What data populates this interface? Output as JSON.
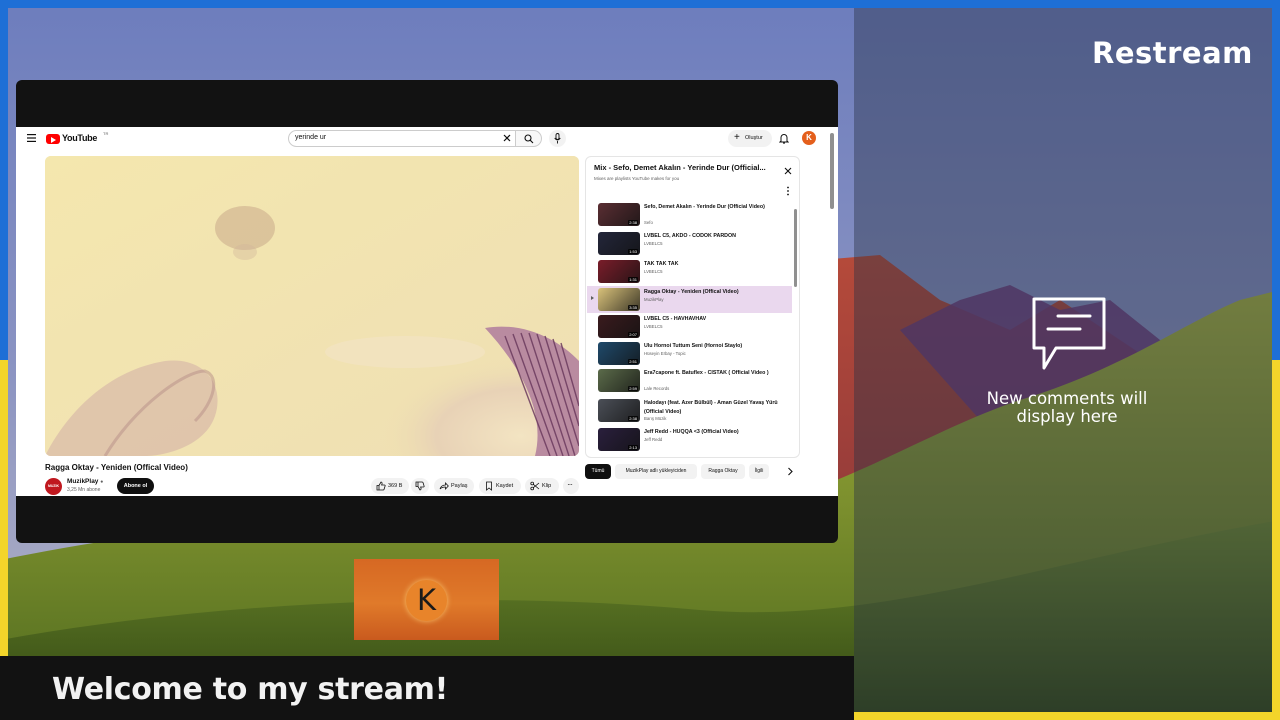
{
  "brand": "Restream",
  "banner": "Welcome to my stream!",
  "chat": {
    "empty_message": "New comments will display here",
    "icon": "chat-bubble-icon"
  },
  "camera": {
    "avatar_letter": "K",
    "color": "#e07a2a"
  },
  "youtube": {
    "search_value": "yerinde ur",
    "create_label": "Oluştur",
    "avatar_letter": "K",
    "logo_text": "YouTube",
    "logo_country": "TR",
    "video_title": "Ragga Oktay - Yeniden (Offical Video)",
    "channel_name": "MuzikPlay",
    "channel_avatar_text": "MUZIK PLAY",
    "subscribers": "3,25 Mn abone",
    "subscribe_label": "Abone ol",
    "actions": {
      "likes": "369 B",
      "share": "Paylaş",
      "save": "Kaydet",
      "clip": "Klip"
    },
    "playlist": {
      "title": "Mix - Sefo, Demet Akalın - Yerinde Dur (Official...",
      "subtitle": "Mixes are playlists YouTube makes for you",
      "items": [
        {
          "title": "Sefo, Demet Akalın - Yerinde Dur (Official Video)",
          "channel": "Sefo",
          "duration": "2:38",
          "color": "#5a2e33"
        },
        {
          "title": "LVBEL C5, AKDO - CODOK PARDON",
          "channel": "LVBELC5",
          "duration": "1:53",
          "color": "#23263a"
        },
        {
          "title": "TAK TAK TAK",
          "channel": "LVBELC5",
          "duration": "1:31",
          "color": "#7a1d2a"
        },
        {
          "title": "Ragga Oktay - Yeniden (Offical Video)",
          "channel": "MuzikPlay",
          "duration": "3:35",
          "color": "#d9c27a"
        },
        {
          "title": "LVBEL C5 - HAVHAVHAV",
          "channel": "LVBELC5",
          "duration": "2:07",
          "color": "#3a1b1e"
        },
        {
          "title": "Ulu Hornoi Tuttum Seni (Hornoi Staylo)",
          "channel": "Hüseyin Erbay - Topic",
          "duration": "2:51",
          "color": "#1f4a6b"
        },
        {
          "title": "Era7capone ft. Batuflex - CISTAK ( Official Video )",
          "channel": "Lale Records",
          "duration": "2:59",
          "color": "#5b6b4a"
        },
        {
          "title": "Halodayı (feat. Azer Bülbül) - Aman Güzel Yavaş Yürü (Official Video)",
          "channel": "Barış Müzik",
          "duration": "2:38",
          "color": "#4b4f57"
        },
        {
          "title": "Jeff Redd - HUQQA <3 (Official Video)",
          "channel": "Jeff Redd",
          "duration": "2:13",
          "color": "#2a1f3d"
        }
      ]
    },
    "chips": [
      "Tümü",
      "MuzikPlay adlı yükleyiciden",
      "Ragga Oktay",
      "İlgili"
    ]
  }
}
